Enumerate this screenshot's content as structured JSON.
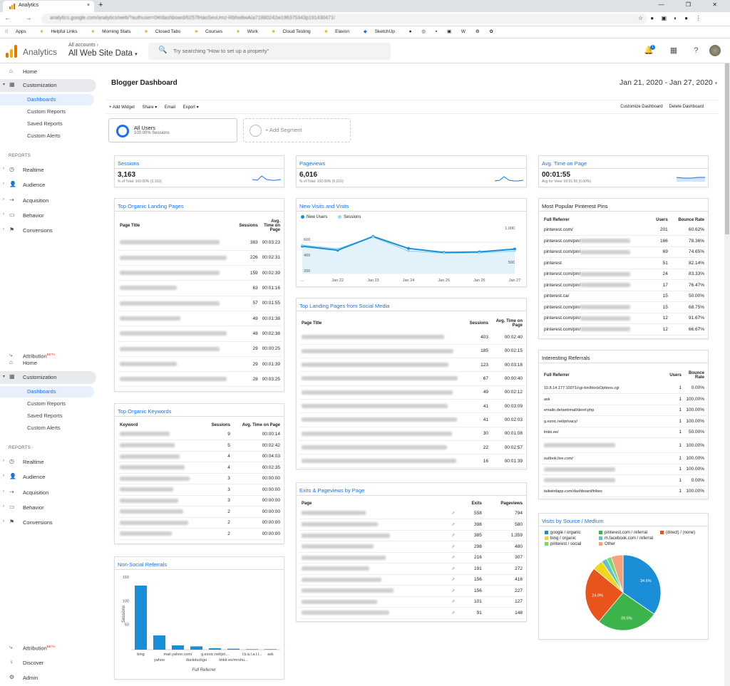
{
  "browser": {
    "tab_title": "Analytics",
    "close": "×",
    "new_tab": "+",
    "url": "analytics.google.com/analytics/web/?authuser=0#/dashboard/6257lHaoSeuUmz-Rbhw8wA/a71880242w196375343p191430471/",
    "window_controls": "— ❐ ✕",
    "nav": "← → C",
    "ext_icons": "☆ ● ▣ ◐ ● ⋮"
  },
  "bookmarks": [
    "Apps",
    "Helpful Links",
    "Morning Stats",
    "Closed Tabs",
    "Courses",
    "Work",
    "Cloud Testing",
    "Elavon",
    "SketchUp"
  ],
  "header": {
    "title": "Analytics",
    "accounts_label": "All accounts ›",
    "property": "All Web Site Data",
    "search_placeholder": "Try searching \"How to set up a property\"",
    "search_icon": "🔍",
    "notif_count": "1",
    "icons": "🔔 ▦ ? ⋮"
  },
  "sidebar": {
    "top": [
      {
        "label": "Home",
        "icon": "⌂"
      },
      {
        "label": "Customization",
        "icon": "▦"
      }
    ],
    "subs": [
      "Dashboards",
      "Custom Reports",
      "Saved Reports",
      "Custom Alerts"
    ],
    "reports_head": "REPORTS",
    "reports": [
      {
        "label": "Realtime",
        "icon": "◷"
      },
      {
        "label": "Audience",
        "icon": "👤"
      },
      {
        "label": "Acquisition",
        "icon": "⇢"
      },
      {
        "label": "Behavior",
        "icon": "▭"
      },
      {
        "label": "Conversions",
        "icon": "⚑"
      }
    ],
    "attribution": "Attribution",
    "beta": "BETA",
    "discover": "Discover",
    "admin": "Admin"
  },
  "dashboard": {
    "title": "Blogger Dashboard",
    "date_range": "Jan 21, 2020 - Jan 27, 2020",
    "toolbar": {
      "add_widget": "+ Add Widget",
      "share": "Share ▾",
      "email": "Email",
      "export": "Export ▾",
      "customize": "Customize Dashboard",
      "delete": "Delete Dashboard"
    },
    "segment": {
      "name": "All Users",
      "pct": "100.00% Sessions",
      "add": "+ Add Segment"
    }
  },
  "sessions": {
    "title": "Sessions",
    "value": "3,163",
    "note": "% of Total: 100.00% (3,163)"
  },
  "pageviews": {
    "title": "Pageviews",
    "value": "6,016",
    "note": "% of Total: 100.00% (6,016)"
  },
  "avgtime": {
    "title": "Avg. Time on Page",
    "value": "00:01:55",
    "note": "Avg for View: 00:01:55 (0.00%)"
  },
  "landing": {
    "title": "Top Organic Landing Pages",
    "headers": [
      "Page Title",
      "Sessions",
      "Avg. Time on Page"
    ],
    "rows": [
      [
        "383",
        "00:03:23"
      ],
      [
        "226",
        "00:02:31"
      ],
      [
        "159",
        "00:02:39"
      ],
      [
        "63",
        "00:01:16"
      ],
      [
        "57",
        "00:01:55"
      ],
      [
        "49",
        "00:01:38"
      ],
      [
        "48",
        "00:02:38"
      ],
      [
        "29",
        "00:00:25"
      ],
      [
        "29",
        "00:01:39"
      ],
      [
        "28",
        "00:03:25"
      ]
    ]
  },
  "keywords": {
    "title": "Top Organic Keywords",
    "headers": [
      "Keyword",
      "Sessions",
      "Avg. Time on Page"
    ],
    "rows": [
      [
        "9",
        "00:00:14"
      ],
      [
        "5",
        "00:02:42"
      ],
      [
        "4",
        "00:04:03"
      ],
      [
        "4",
        "00:02:35"
      ],
      [
        "3",
        "00:00:00"
      ],
      [
        "3",
        "00:00:00"
      ],
      [
        "3",
        "00:00:00"
      ],
      [
        "2",
        "00:00:00"
      ],
      [
        "2",
        "00:00:00"
      ],
      [
        "2",
        "00:00:00"
      ]
    ]
  },
  "nonsocial": {
    "title": "Non-Social Referrals",
    "ylabel": "Sessions",
    "xlabel": "Full Referrer",
    "yticks": [
      "150",
      "100",
      "50"
    ],
    "xlabels_top": [
      "bing",
      "mail.yahoo.com/",
      "g.ezoic.net/pri...",
      "l.b.a.l.a.l.l...",
      "ask"
    ],
    "xlabels_bottom": [
      "yahoo",
      "duckduckgo",
      "linktr.ee/mrshu..."
    ]
  },
  "newvisits": {
    "title": "New Visits and Visits",
    "legend": [
      "New Users",
      "Sessions"
    ],
    "yleft": [
      "600",
      "400",
      "200"
    ],
    "yright": [
      "1,000",
      "500"
    ],
    "xlabels": [
      "...",
      "Jan 22",
      "Jan 23",
      "Jan 24",
      "Jan 25",
      "Jan 26",
      "Jan 27"
    ]
  },
  "social": {
    "title": "Top Landing Pages from Social Media",
    "headers": [
      "Page Title",
      "Sessions",
      "Avg. Time on Page"
    ],
    "rows": [
      [
        "403",
        "00:02:40"
      ],
      [
        "185",
        "00:02:15"
      ],
      [
        "123",
        "00:03:18"
      ],
      [
        "67",
        "00:00:40"
      ],
      [
        "49",
        "00:02:12"
      ],
      [
        "41",
        "00:03:09"
      ],
      [
        "41",
        "00:02:03"
      ],
      [
        "30",
        "00:01:08"
      ],
      [
        "22",
        "00:02:57"
      ],
      [
        "16",
        "00:01:39"
      ]
    ]
  },
  "exits": {
    "title": "Exits & Pageviews by Page",
    "headers": [
      "Page",
      "Exits",
      "Pageviews"
    ],
    "rows": [
      [
        "558",
        "794"
      ],
      [
        "398",
        "580"
      ],
      [
        "385",
        "1,359"
      ],
      [
        "298",
        "480"
      ],
      [
        "216",
        "307"
      ],
      [
        "191",
        "272"
      ],
      [
        "156",
        "416"
      ],
      [
        "156",
        "227"
      ],
      [
        "101",
        "127"
      ],
      [
        "91",
        "148"
      ]
    ]
  },
  "pins": {
    "title": "Most Popular Pinterest Pins",
    "headers": [
      "Full Referrer",
      "Users",
      "Bounce Rate"
    ],
    "rows": [
      [
        "pinterest.com/",
        "201",
        "60.62%"
      ],
      [
        "pinterest.com/pin/",
        "166",
        "78.36%"
      ],
      [
        "pinterest.com/pin/",
        "69",
        "74.65%"
      ],
      [
        "pinterest",
        "51",
        "82.14%"
      ],
      [
        "pinterest.com/pin/",
        "24",
        "83.33%"
      ],
      [
        "pinterest.com/pin/",
        "17",
        "76.47%"
      ],
      [
        "pinterest.ca/",
        "15",
        "50.00%"
      ],
      [
        "pinterest.com/pin/",
        "15",
        "68.75%"
      ],
      [
        "pinterest.com/pin/",
        "12",
        "91.67%"
      ],
      [
        "pinterest.com/pin/",
        "12",
        "66.67%"
      ]
    ]
  },
  "referrals": {
    "title": "Interesting Referrals",
    "headers": [
      "Full Referrer",
      "Users",
      "Bounce Rate"
    ],
    "rows": [
      [
        "10.8.14.177:10071/cgi-bin/blockOptions.cgi",
        "1",
        "0.00%"
      ],
      [
        "ask",
        "1",
        "100.00%"
      ],
      [
        "emailn.de/webmail/deref.php",
        "1",
        "100.00%"
      ],
      [
        "g.ezoic.net/privacy/",
        "1",
        "100.00%"
      ],
      [
        "linktr.ee/",
        "1",
        "50.00%"
      ],
      [
        "",
        "1",
        "100.00%"
      ],
      [
        "outlook.live.com/",
        "1",
        "100.00%"
      ],
      [
        "",
        "1",
        "100.00%"
      ],
      [
        "",
        "1",
        "0.00%"
      ],
      [
        "tailwindapp.com/dashboard/tribes",
        "1",
        "100.00%"
      ]
    ]
  },
  "sources": {
    "title": "Visits by Source / Medium",
    "legend": [
      "google / organic",
      "pinterest.com / referral",
      "(direct) / (none)",
      "bing / organic",
      "m.facebook.com / referral",
      "pinterest / social",
      "Other"
    ],
    "colors": [
      "#1a8fd8",
      "#3cb44b",
      "#e8541c",
      "#f2d61b",
      "#64c1c8",
      "#77d96b",
      "#f7a07c"
    ],
    "labels": [
      "34.6%",
      "26.5%",
      "24.9%"
    ]
  },
  "chart_data": [
    {
      "type": "line",
      "title": "New Visits and Visits",
      "x": [
        "Jan 21",
        "Jan 22",
        "Jan 23",
        "Jan 24",
        "Jan 25",
        "Jan 26",
        "Jan 27"
      ],
      "series": [
        {
          "name": "New Users",
          "values": [
            480,
            410,
            650,
            440,
            370,
            380,
            430
          ]
        },
        {
          "name": "Sessions",
          "values": [
            780,
            680,
            1000,
            620,
            560,
            570,
            620
          ]
        }
      ]
    },
    {
      "type": "bar",
      "title": "Non-Social Referrals",
      "categories": [
        "bing",
        "yahoo",
        "mail.yahoo.com/",
        "duckduckgo",
        "g.ezoic.net/pri...",
        "linktr.ee/mrshu...",
        "...",
        "ask"
      ],
      "values": [
        135,
        30,
        9,
        7,
        3,
        2,
        1,
        1
      ],
      "ylabel": "Sessions",
      "xlabel": "Full Referrer",
      "ylim": [
        0,
        150
      ]
    },
    {
      "type": "pie",
      "title": "Visits by Source / Medium",
      "categories": [
        "google / organic",
        "pinterest.com / referral",
        "(direct) / (none)",
        "bing / organic",
        "m.facebook.com / referral",
        "pinterest / social",
        "Other"
      ],
      "values": [
        34.6,
        26.5,
        24.9,
        4.5,
        2.4,
        2.0,
        5.1
      ]
    }
  ]
}
